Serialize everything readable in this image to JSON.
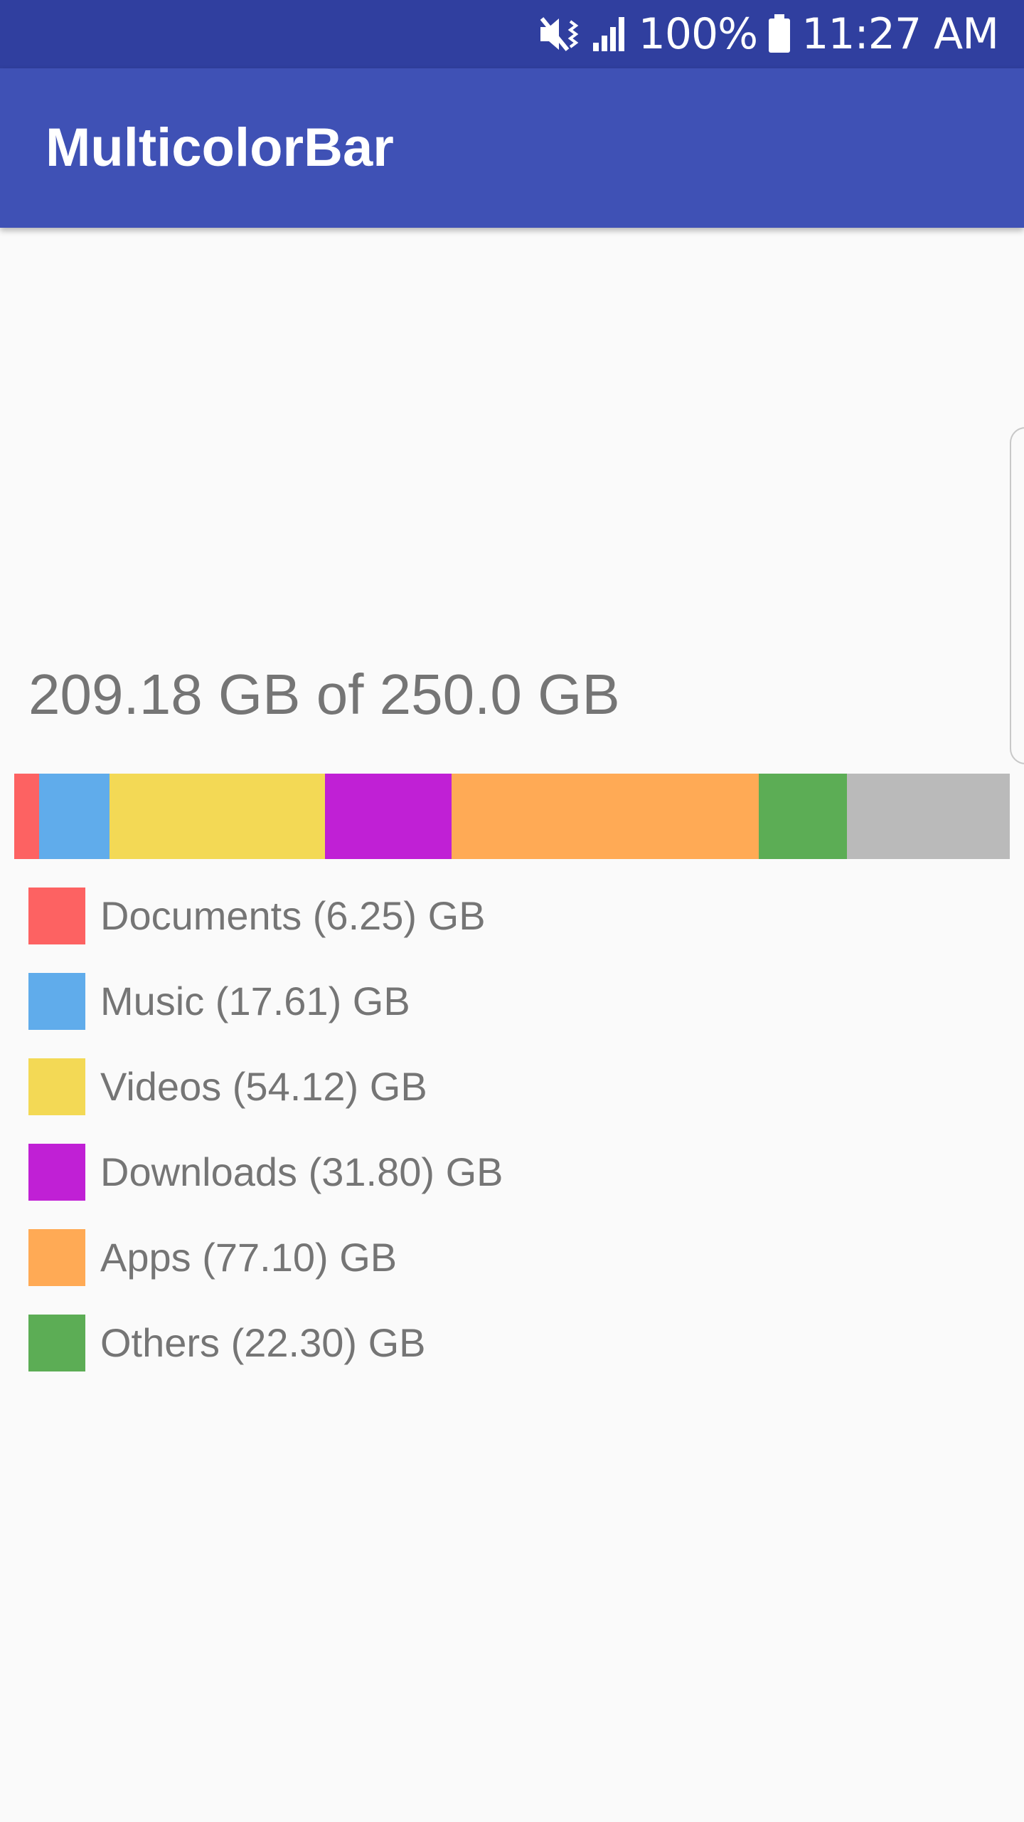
{
  "status_bar": {
    "icons": [
      "vibrate-mute-icon",
      "signal-icon",
      "battery-icon"
    ],
    "battery": "100%",
    "time": "11:27 AM"
  },
  "app_bar": {
    "title": "MulticolorBar"
  },
  "storage": {
    "summary": "209.18 GB of 250.0 GB",
    "used_gb": 209.18,
    "total_gb": 250.0,
    "free_color": "#bababa",
    "categories": [
      {
        "label": "Documents (6.25) GB",
        "value": 6.25,
        "color": "#fd6262"
      },
      {
        "label": "Music (17.61) GB",
        "value": 17.61,
        "color": "#60aceb"
      },
      {
        "label": "Videos (54.12) GB",
        "value": 54.12,
        "color": "#f3d955"
      },
      {
        "label": "Downloads (31.80) GB",
        "value": 31.8,
        "color": "#c020d5"
      },
      {
        "label": "Apps (77.10) GB",
        "value": 77.1,
        "color": "#ffaa55"
      },
      {
        "label": "Others (22.30) GB",
        "value": 22.3,
        "color": "#5cad55"
      }
    ]
  }
}
